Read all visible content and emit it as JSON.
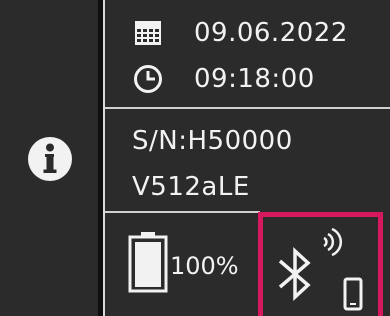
{
  "status": {
    "date": "09.06.2022",
    "time": "09:18:00",
    "serial": "S/N:H50000",
    "version": "V512aLE",
    "battery_percent": "100%",
    "battery_level": 1.0
  },
  "icons": {
    "info": "info-icon",
    "calendar": "calendar-icon",
    "clock": "clock-icon",
    "battery": "battery-icon",
    "bluetooth": "bluetooth-icon",
    "signal": "wireless-signal-icon",
    "phone": "phone-icon"
  },
  "colors": {
    "background": "#2b2b2b",
    "text": "#f2f2f2",
    "highlight": "#d6185f"
  }
}
